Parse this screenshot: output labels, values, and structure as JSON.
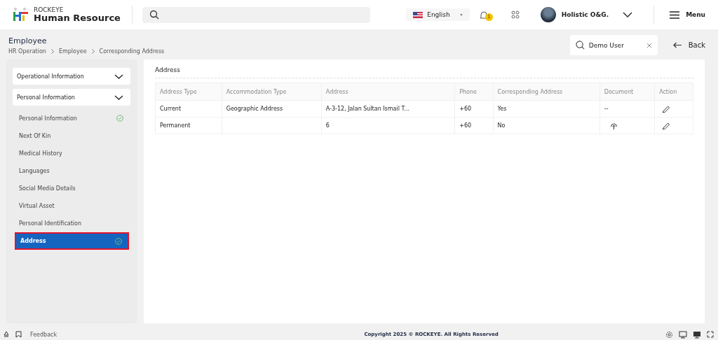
{
  "brand": {
    "top": "ROCKEYE",
    "name": "Human Resource"
  },
  "header": {
    "language": "English",
    "notification_count": "1",
    "user": "Holistic O&G.",
    "menu": "Menu"
  },
  "page": {
    "title": "Employee",
    "breadcrumb": [
      "HR Operation",
      "Employee",
      "Corresponding Address"
    ],
    "search_value": "Demo User",
    "back": "Back"
  },
  "sidebar": {
    "sections": [
      {
        "label": "Operational Information"
      },
      {
        "label": "Personal Information",
        "children": [
          {
            "label": "Personal Information",
            "selected": false,
            "completed": true
          },
          {
            "label": "Next Of Kin",
            "selected": false,
            "completed": false
          },
          {
            "label": "Medical History",
            "selected": false,
            "completed": false
          },
          {
            "label": "Languages",
            "selected": false,
            "completed": false
          },
          {
            "label": "Social Media Details",
            "selected": false,
            "completed": false
          },
          {
            "label": "Virtual Asset",
            "selected": false,
            "completed": false
          },
          {
            "label": "Personal Identification",
            "selected": false,
            "completed": false
          },
          {
            "label": "Address",
            "selected": true,
            "completed": true
          }
        ]
      }
    ]
  },
  "section_title": "Address",
  "table": {
    "columns": [
      "Address Type",
      "Accommodation Type",
      "Address",
      "Phone",
      "Corresponding Address",
      "Document",
      "Action"
    ],
    "rows": [
      {
        "address_type": "Current",
        "accommodation_type": "Geographic Address",
        "address": "A-3-12, Jalan Sultan Ismail T...",
        "phone": "+60",
        "corresponding": "Yes",
        "document": {
          "kind": "text",
          "text": "--"
        }
      },
      {
        "address_type": "Permanent",
        "accommodation_type": "",
        "address": "6",
        "phone": "+60",
        "corresponding": "No",
        "document": {
          "kind": "upload"
        }
      }
    ]
  },
  "footer": {
    "feedback": "Feedback",
    "copyright": "Copyright 2025 © ROCKEYE. All Rights Reserved"
  }
}
